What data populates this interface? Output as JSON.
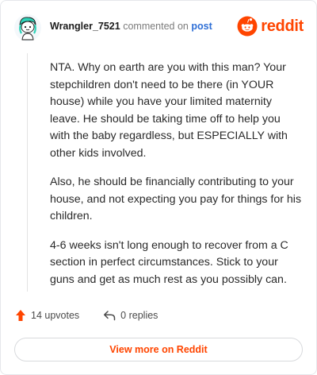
{
  "header": {
    "username": "Wrangler_7521",
    "action": "commented on",
    "post_link": "post"
  },
  "brand": {
    "name": "reddit",
    "icon": "reddit-alien-logo",
    "color": "#ff4500"
  },
  "comment": {
    "paragraphs": [
      "NTA. Why on earth are you with this man? Your stepchildren don't need to be there (in YOUR house) while you have your limited maternity leave. He should be taking time off to help you with the baby regardless, but ESPECIALLY with other kids involved.",
      "Also, he should be financially contributing to your house, and not expecting you pay for things for his children.",
      "4-6 weeks isn't long enough to recover from a C section in perfect circumstances. Stick to your guns and get as much rest as you possibly can."
    ]
  },
  "actions": {
    "upvotes_label": "14 upvotes",
    "upvote_icon": "upvote-arrow-icon",
    "upvote_color": "#ff4500",
    "replies_label": "0 replies",
    "reply_icon": "reply-arrow-icon"
  },
  "footer": {
    "view_more_label": "View more on Reddit"
  }
}
